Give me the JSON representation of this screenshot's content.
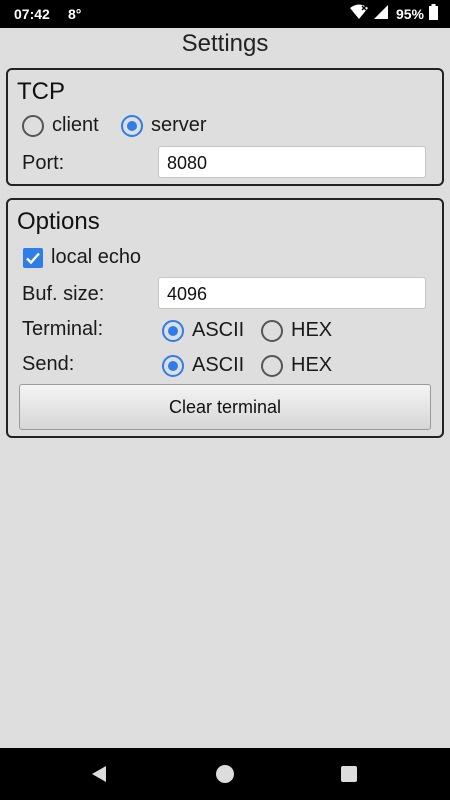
{
  "status_bar": {
    "time": "07:42",
    "temperature": "8°",
    "battery": "95%"
  },
  "page_title": "Settings",
  "tcp": {
    "title": "TCP",
    "mode_options": [
      {
        "label": "client",
        "checked": false
      },
      {
        "label": "server",
        "checked": true
      }
    ],
    "port_label": "Port:",
    "port_value": "8080"
  },
  "options": {
    "title": "Options",
    "local_echo_label": "local echo",
    "local_echo_checked": true,
    "buf_size_label": "Buf. size:",
    "buf_size_value": "4096",
    "terminal_label": "Terminal:",
    "terminal_options": [
      {
        "label": "ASCII",
        "checked": true
      },
      {
        "label": "HEX",
        "checked": false
      }
    ],
    "send_label": "Send:",
    "send_options": [
      {
        "label": "ASCII",
        "checked": true
      },
      {
        "label": "HEX",
        "checked": false
      }
    ],
    "clear_button_label": "Clear terminal"
  },
  "colors": {
    "accent": "#2f7ee8",
    "background": "#dedede"
  },
  "icons": {
    "wifi": "wifi-icon",
    "signal": "signal-icon",
    "battery": "battery-icon",
    "back": "back-icon",
    "home": "home-icon",
    "recents": "recents-icon"
  }
}
